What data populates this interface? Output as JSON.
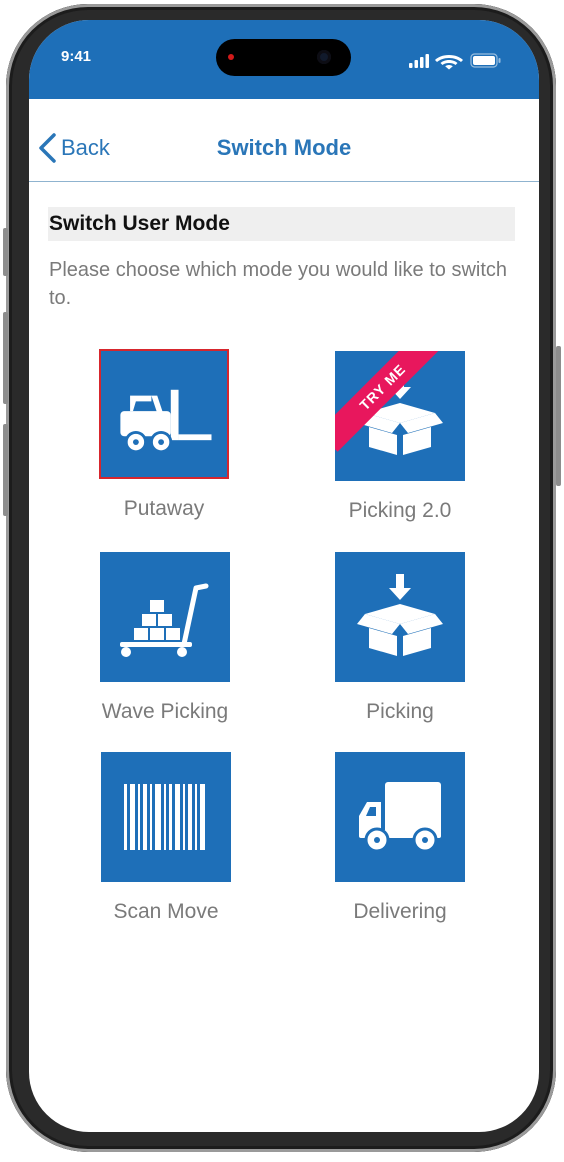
{
  "status_bar": {
    "time": "9:41"
  },
  "nav": {
    "back_label": "Back",
    "title": "Switch Mode"
  },
  "section": {
    "title": "Switch User Mode",
    "prompt": "Please choose which mode you would like to switch to."
  },
  "modes": [
    {
      "label": "Putaway",
      "icon": "forklift-icon",
      "selected": true
    },
    {
      "label": "Picking 2.0",
      "icon": "open-box-icon",
      "badge": "TRY ME"
    },
    {
      "label": "Wave Picking",
      "icon": "hand-truck-icon"
    },
    {
      "label": "Picking",
      "icon": "open-box-icon"
    },
    {
      "label": "Scan Move",
      "icon": "barcode-icon"
    },
    {
      "label": "Delivering",
      "icon": "truck-icon"
    }
  ],
  "colors": {
    "accent": "#1e6fb8",
    "link": "#2a76b8",
    "badge": "#e8175d",
    "selected_border": "#d7262d"
  }
}
